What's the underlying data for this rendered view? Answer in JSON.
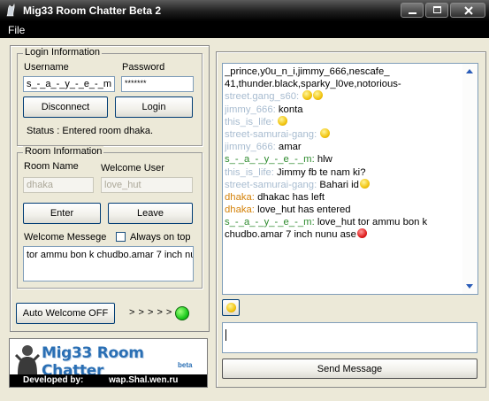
{
  "window": {
    "title": "Mig33 Room Chatter Beta 2"
  },
  "menu": {
    "file": "File"
  },
  "login": {
    "group_title": "Login Information",
    "username_label": "Username",
    "password_label": "Password",
    "username_value": "s_-_a_-_y_-_e_-_m",
    "password_value": "*******",
    "disconnect_label": "Disconnect",
    "login_label": "Login",
    "status_text": "Status : Entered room dhaka."
  },
  "room": {
    "group_title": "Room Information",
    "room_name_label": "Room Name",
    "welcome_user_label": "Welcome User",
    "room_name_value": "dhaka",
    "welcome_user_value": "love_hut",
    "enter_label": "Enter",
    "leave_label": "Leave",
    "welcome_message_label": "Welcome Messege",
    "always_on_top_label": "Always on top",
    "welcome_message_value": "tor ammu bon k chudbo.amar 7 inch nu"
  },
  "auto_welcome": {
    "label": "Auto Welcome OFF",
    "arrows": "> > > > >"
  },
  "logo": {
    "title": "Mig33 Room Chatter",
    "beta": "beta",
    "developed_by": "Developed by:",
    "site": "wap.Shal.wen.ru"
  },
  "chat": {
    "colors": {
      "text": "#000000",
      "gray": "#a8bcd0",
      "green": "#2e8b2e",
      "orange": "#d4820a"
    },
    "lines": [
      {
        "name": "",
        "text": "_prince,y0u_n_i,jimmy_666,nescafe_",
        "name_color": "gray",
        "emoticons": []
      },
      {
        "name": "",
        "text": "41,thunder.black,sparky_l0ve,notorious-",
        "name_color": "gray",
        "emoticons": []
      },
      {
        "name": "street.gang_s60:",
        "text": "",
        "name_color": "gray",
        "emoticons": [
          "smile",
          "smile"
        ]
      },
      {
        "name": "jimmy_666:",
        "text": "konta",
        "name_color": "gray",
        "emoticons": []
      },
      {
        "name": "this_is_life:",
        "text": "",
        "name_color": "gray",
        "emoticons": [
          "smile"
        ]
      },
      {
        "name": "street-samurai-gang:",
        "text": "",
        "name_color": "gray",
        "emoticons": [
          "tongue"
        ]
      },
      {
        "name": "jimmy_666:",
        "text": "amar",
        "name_color": "gray",
        "emoticons": []
      },
      {
        "name": "s_-_a_-_y_-_e_-_m:",
        "text": "hlw",
        "name_color": "green",
        "emoticons": []
      },
      {
        "name": "this_is_life:",
        "text": "Jimmy fb te nam ki?",
        "name_color": "gray",
        "emoticons": []
      },
      {
        "name": "street-samurai-gang:",
        "text": "Bahari id",
        "name_color": "gray",
        "emoticons": [
          "tongue"
        ]
      },
      {
        "name": "dhaka:",
        "text": "dhakac has left",
        "name_color": "orange",
        "emoticons": []
      },
      {
        "name": "dhaka:",
        "text": "love_hut has entered",
        "name_color": "orange",
        "emoticons": []
      },
      {
        "name": "s_-_a_-_y_-_e_-_m:",
        "text": "love_hut tor ammu bon k",
        "name_color": "green",
        "emoticons": []
      },
      {
        "name": "",
        "text": "chudbo.amar 7 inch nunu ase",
        "name_color": "gray",
        "emoticons": [
          "angry"
        ]
      }
    ]
  },
  "message_input": {
    "value": ""
  },
  "send_button": {
    "label": "Send Message"
  }
}
